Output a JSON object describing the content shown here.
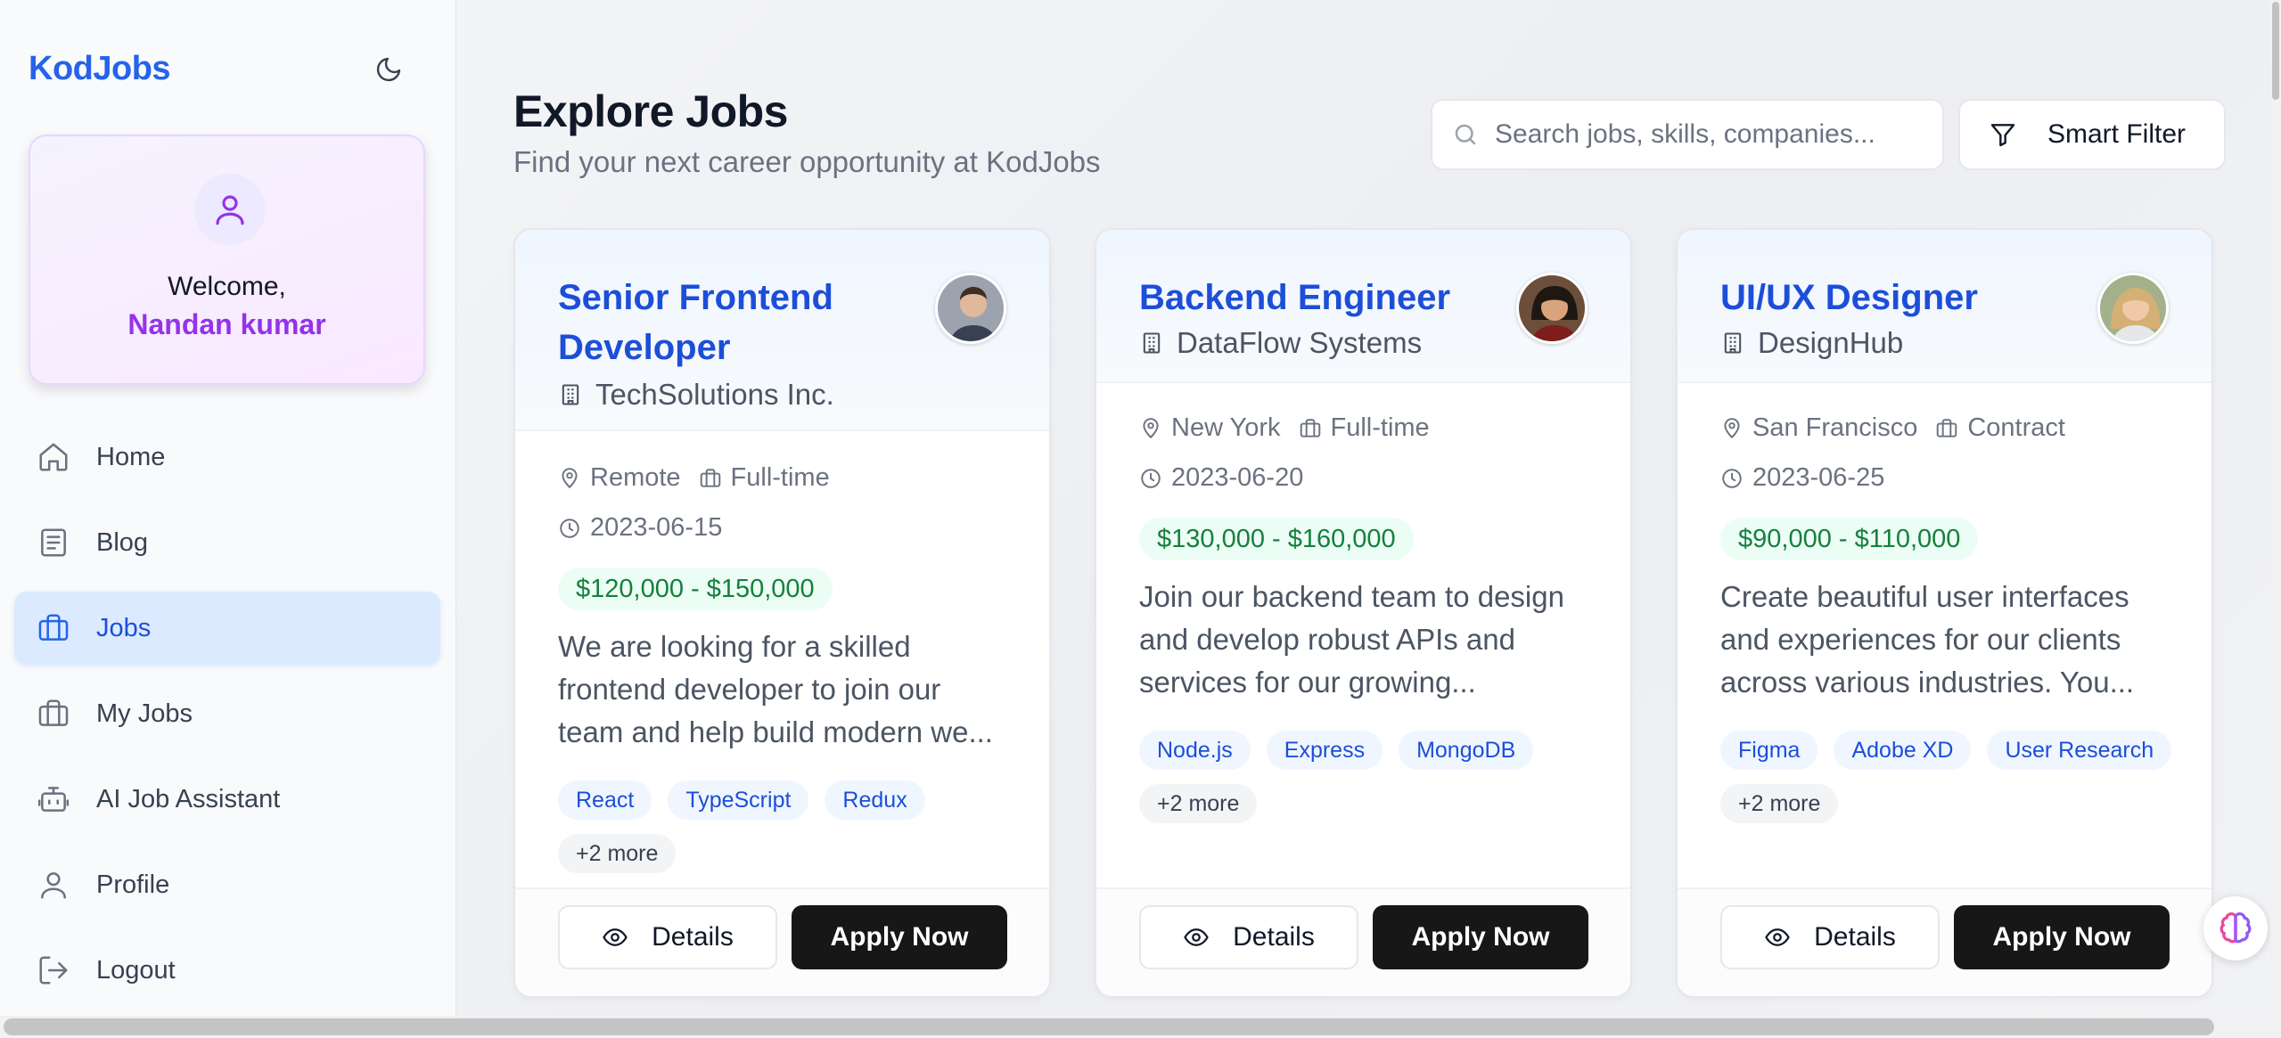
{
  "app": {
    "brand": "KodJobs"
  },
  "welcome": {
    "greeting": "Welcome,",
    "name": "Nandan kumar"
  },
  "nav": [
    {
      "label": "Home",
      "icon": "home-icon",
      "active": false
    },
    {
      "label": "Blog",
      "icon": "document-icon",
      "active": false
    },
    {
      "label": "Jobs",
      "icon": "briefcase-icon",
      "active": true
    },
    {
      "label": "My Jobs",
      "icon": "briefcase-icon",
      "active": false
    },
    {
      "label": "AI Job Assistant",
      "icon": "robot-icon",
      "active": false
    },
    {
      "label": "Profile",
      "icon": "user-icon",
      "active": false
    },
    {
      "label": "Logout",
      "icon": "logout-icon",
      "active": false
    }
  ],
  "header": {
    "title": "Explore Jobs",
    "subtitle": "Find your next career opportunity at KodJobs"
  },
  "search": {
    "placeholder": "Search jobs, skills, companies...",
    "value": ""
  },
  "filter": {
    "label": "Smart Filter"
  },
  "jobs": [
    {
      "title": "Senior Frontend Developer",
      "company": "TechSolutions Inc.",
      "location": "Remote",
      "type": "Full-time",
      "date": "2023-06-15",
      "salary": "$120,000 - $150,000",
      "description": "We are looking for a skilled frontend developer to join our team and help build modern we...",
      "tags": [
        "React",
        "TypeScript",
        "Redux"
      ],
      "more": "+2 more",
      "details_label": "Details",
      "apply_label": "Apply Now"
    },
    {
      "title": "Backend Engineer",
      "company": "DataFlow Systems",
      "location": "New York",
      "type": "Full-time",
      "date": "2023-06-20",
      "salary": "$130,000 - $160,000",
      "description": "Join our backend team to design and develop robust APIs and services for our growing...",
      "tags": [
        "Node.js",
        "Express",
        "MongoDB"
      ],
      "more": "+2 more",
      "details_label": "Details",
      "apply_label": "Apply Now"
    },
    {
      "title": "UI/UX Designer",
      "company": "DesignHub",
      "location": "San Francisco",
      "type": "Contract",
      "date": "2023-06-25",
      "salary": "$90,000 - $110,000",
      "description": "Create beautiful user interfaces and experiences for our clients across various industries. You...",
      "tags": [
        "Figma",
        "Adobe XD",
        "User Research"
      ],
      "more": "+2 more",
      "details_label": "Details",
      "apply_label": "Apply Now"
    }
  ],
  "colors": {
    "accent": "#2563eb",
    "purple": "#9333ea",
    "salary": "#15803d",
    "apply": "#171717"
  }
}
